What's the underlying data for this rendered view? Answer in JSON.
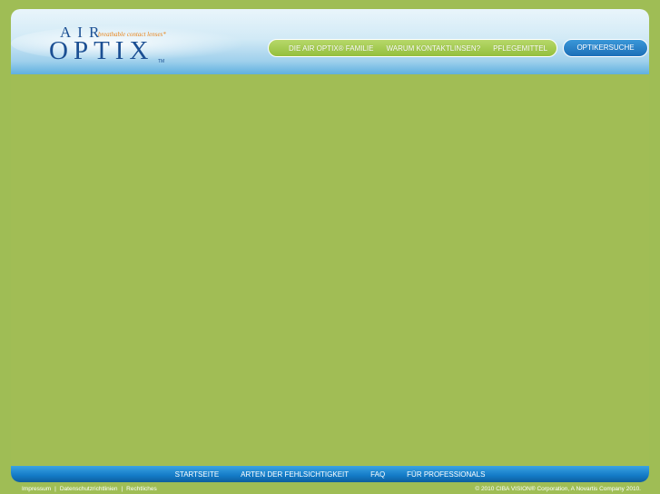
{
  "logo": {
    "air": "AIR",
    "optix": "OPTIX",
    "tagline": "breathable contact lenses*",
    "tm": "TM"
  },
  "top_nav": {
    "items": [
      "DIE AIR OPTIX® FAMILIE",
      "WARUM KONTAKTLINSEN?",
      "PFLEGEMITTEL"
    ],
    "search_label": "OPTIKERSUCHE"
  },
  "bottom_nav": {
    "items": [
      "STARTSEITE",
      "ARTEN DER FEHLSICHTIGKEIT",
      "FAQ",
      "FÜR PROFESSIONALS"
    ]
  },
  "footer": {
    "links": [
      "Impressum",
      "Datenschutzrichtlinien",
      "Rechtliches"
    ],
    "separator": "|",
    "copyright": "© 2010 CIBA VISION® Corporation, A Novartis Company 2010."
  },
  "colors": {
    "page_bg": "#9fbd55",
    "nav_green": "#94bf3d",
    "nav_blue": "#1c6fb8",
    "logo_blue": "#1b4f93",
    "tagline_orange": "#e8851c"
  }
}
